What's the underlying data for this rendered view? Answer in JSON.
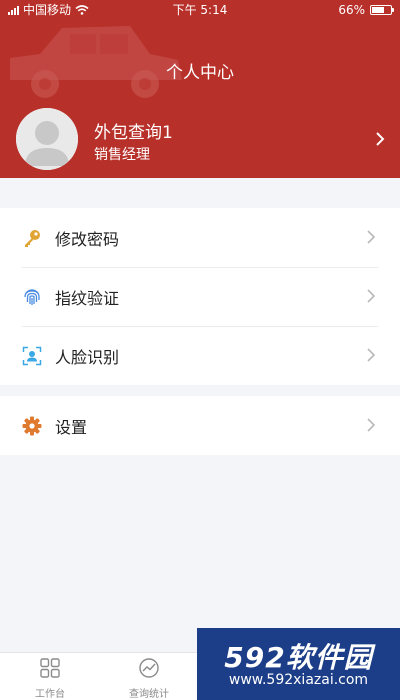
{
  "status_bar": {
    "carrier": "中国移动",
    "time": "下午 5:14",
    "battery": "66%",
    "battery_level": 0.66
  },
  "header": {
    "title": "个人中心"
  },
  "profile": {
    "name": "外包查询1",
    "role": "销售经理"
  },
  "menu": {
    "security": [
      {
        "icon": "key-icon",
        "label": "修改密码"
      },
      {
        "icon": "fingerprint-icon",
        "label": "指纹验证"
      },
      {
        "icon": "face-id-icon",
        "label": "人脸识别"
      }
    ],
    "settings": [
      {
        "icon": "gear-icon",
        "label": "设置"
      }
    ]
  },
  "tabbar": {
    "items": [
      {
        "icon": "grid-icon",
        "label": "工作台"
      },
      {
        "icon": "chart-icon",
        "label": "查询统计"
      }
    ]
  },
  "watermark": {
    "title": "592软件园",
    "url": "www.592xiazai.com"
  },
  "colors": {
    "header_bg": "#b8302a",
    "page_bg": "#f4f5f9",
    "key_icon": "#e0a435",
    "fingerprint_icon": "#4a8be0",
    "face_icon": "#3aa7e6",
    "gear_icon": "#e07a2e"
  }
}
